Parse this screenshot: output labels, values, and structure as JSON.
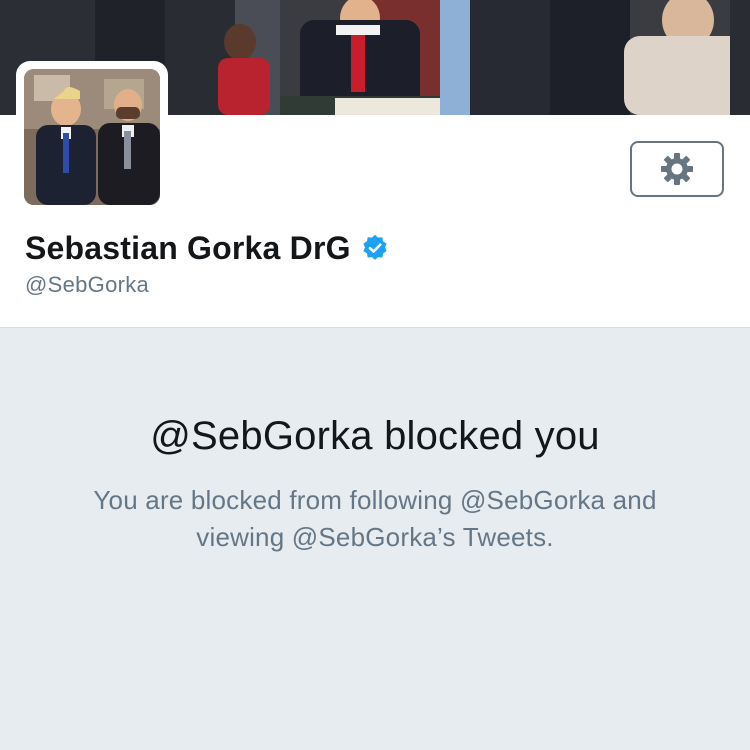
{
  "profile": {
    "display_name": "Sebastian Gorka DrG",
    "screen_name": "@SebGorka",
    "verified": true
  },
  "icons": {
    "settings": "gear-icon",
    "verified": "verified-badge-icon"
  },
  "blocked_notice": {
    "title": "@SebGorka blocked you",
    "message": "You are blocked from following @SebGorka and viewing @SebGorka’s Tweets."
  },
  "colors": {
    "verified_blue": "#1da1f2",
    "panel_background": "#e6ecf0",
    "secondary_text": "#657786",
    "primary_text": "#14171a"
  }
}
